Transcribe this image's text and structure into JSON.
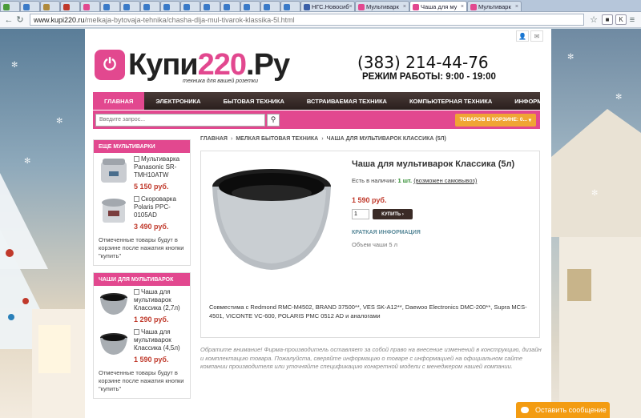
{
  "browser": {
    "tabs": [
      {
        "label": "",
        "color": "#4a9b3a",
        "size": "small"
      },
      {
        "label": "",
        "color": "#3a7ac8",
        "size": "small"
      },
      {
        "label": "",
        "color": "#b08a3c",
        "size": "small"
      },
      {
        "label": "",
        "color": "#c0392b",
        "size": "small"
      },
      {
        "label": "",
        "color": "#e2488f",
        "size": "small"
      },
      {
        "label": "",
        "color": "#3a7ac8",
        "size": "small"
      },
      {
        "label": "",
        "color": "#3a7ac8",
        "size": "small"
      },
      {
        "label": "",
        "color": "#3a7ac8",
        "size": "small"
      },
      {
        "label": "",
        "color": "#3a7ac8",
        "size": "small"
      },
      {
        "label": "",
        "color": "#3a7ac8",
        "size": "small"
      },
      {
        "label": "",
        "color": "#3a7ac8",
        "size": "small"
      },
      {
        "label": "",
        "color": "#3a7ac8",
        "size": "small"
      },
      {
        "label": "",
        "color": "#3a7ac8",
        "size": "small"
      },
      {
        "label": "",
        "color": "#3a7ac8",
        "size": "small"
      },
      {
        "label": "",
        "color": "#3a7ac8",
        "size": "small"
      },
      {
        "label": "НГС.Новосиб",
        "color": "#3a5fa8",
        "size": "wide"
      },
      {
        "label": "Мультиварк",
        "color": "#e2488f",
        "size": "wide"
      },
      {
        "label": "Чаша для му",
        "color": "#e2488f",
        "size": "active"
      },
      {
        "label": "Мультиварк",
        "color": "#e2488f",
        "size": "wide"
      }
    ],
    "url_host": "www.kupi220.ru",
    "url_path": "/melkaja-bytovaja-tehnika/chasha-dlja-mul-tivarok-klassika-5l.html"
  },
  "site": {
    "logo_mark": "⏻",
    "logo_text_1": "Купи",
    "logo_text_2": "220",
    "logo_text_3": ".Ру",
    "slogan": "техника для вашей розетки",
    "phone": "(383) 214-44-76",
    "hours": "РЕЖИМ РАБОТЫ:  9:00 - 19:00"
  },
  "nav": [
    {
      "label": "ГЛАВНАЯ",
      "active": true
    },
    {
      "label": "ЭЛЕКТРОНИКА",
      "active": false
    },
    {
      "label": "БЫТОВАЯ ТЕХНИКА",
      "active": false
    },
    {
      "label": "ВСТРАИВАЕМАЯ ТЕХНИКА",
      "active": false
    },
    {
      "label": "КОМПЬЮТЕРНАЯ ТЕХНИКА",
      "active": false
    },
    {
      "label": "ИНФОРМАЦИЯ",
      "active": false
    }
  ],
  "search": {
    "placeholder": "Введите запрос...",
    "icon": "search-icon"
  },
  "cart": {
    "label": "ТОВАРОВ В КОРЗИНЕ: 0..."
  },
  "sidebar": {
    "box1": {
      "title": "ЕЩЕ МУЛЬТИВАРКИ",
      "items": [
        {
          "name": "Мультиварка Panasonic SR-TMH10ATW",
          "price": "5 150 руб."
        },
        {
          "name": "Скороварка Polaris PPC-0105AD",
          "price": "3 490 руб."
        }
      ],
      "note": "Отмеченные товары будут в корзине после нажатия кнопки \"купить\""
    },
    "box2": {
      "title": "ЧАШИ ДЛЯ МУЛЬТИВАРОК",
      "items": [
        {
          "name": "Чаша для мультиварок Классика (2,7л)",
          "price": "1 290 руб."
        },
        {
          "name": "Чаша для мультиварок Классика (4,5л)",
          "price": "1 590 руб."
        }
      ],
      "note": "Отмеченные товары будут в корзине после нажатия кнопки \"купить\""
    }
  },
  "breadcrumbs": [
    "ГЛАВНАЯ",
    "МЕЛКАЯ БЫТОВАЯ ТЕХНИКА",
    "ЧАША ДЛЯ МУЛЬТИВАРОК КЛАССИКА (5Л)"
  ],
  "product": {
    "title": "Чаша для мультиварок Классика (5л)",
    "stock_prefix": "Есть в наличии:",
    "stock_qty": "1 шт.",
    "stock_link": "(возможен самовывоз)",
    "price": "1 590 руб.",
    "qty": "1",
    "buy_label": "КУПИТЬ  ›",
    "short_heading": "КРАТКАЯ ИНФОРМАЦИЯ",
    "short_text": "Объем чаши 5 л",
    "compat": "Совместима с Redmond RMC-M4502, BRAND 37500**, VES SK-A12**, Daewoo Electronics DMC-200**, Supra MCS-4501, VICONTE VC-600, POLARIS PMC 0512 AD и аналогами"
  },
  "disclaimer": "Обратите внимание! Фирма-производитель оставляет за собой право на внесение изменений в конструкцию, дизайн и комплектацию товара. Пожалуйста, сверяйте информацию о товаре с информацией на официальном сайте компании производителя или уточняйте спецификацию конкретной модели с менеджером нашей компании.",
  "chat": {
    "label": "Оставить сообщение"
  },
  "colors": {
    "brand": "#e2488f",
    "nav_dark": "#2a1f1d",
    "price": "#c0392b",
    "cart": "#f0a534",
    "chat": "#f39c12"
  }
}
